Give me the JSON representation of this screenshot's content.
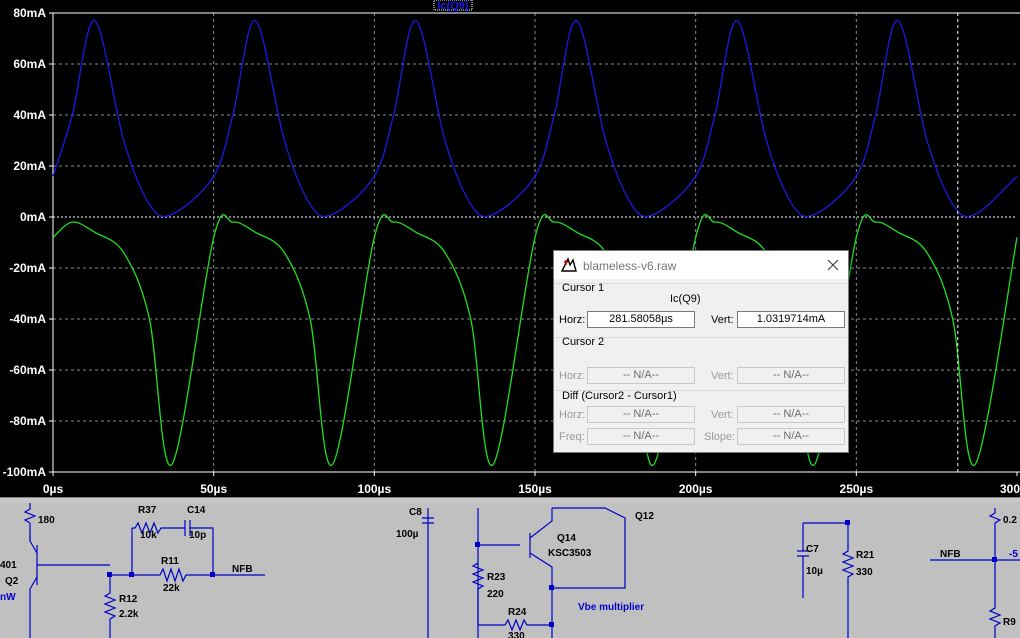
{
  "plot": {
    "trace_label": "Ic(Q9)",
    "colors": {
      "background": "#000000",
      "grid": "#8a8a8a",
      "trace1": "#1a1ae6",
      "trace2": "#1ee01e",
      "zero_line": "#ffffff",
      "cursor": "#ffffff"
    },
    "y_axis": {
      "ticks": [
        "80mA",
        "60mA",
        "40mA",
        "20mA",
        "0mA",
        "-20mA",
        "-40mA",
        "-60mA",
        "-80mA",
        "-100mA"
      ]
    },
    "x_axis": {
      "ticks": [
        "0µs",
        "50µs",
        "100µs",
        "150µs",
        "200µs",
        "250µs",
        "300"
      ]
    }
  },
  "chart_data": {
    "type": "line",
    "xlim": [
      0,
      300
    ],
    "ylim": [
      -100,
      80
    ],
    "x_unit": "µs",
    "y_unit": "mA",
    "period_us": 50,
    "cursor_x_us": 281.58058,
    "series": [
      {
        "name": "Ic(Q9)",
        "x": [
          0,
          6,
          13,
          22,
          30,
          37,
          50,
          56,
          63,
          72,
          80,
          87,
          100,
          106,
          113,
          122,
          130,
          137,
          150,
          156,
          163,
          172,
          180,
          187,
          200,
          206,
          213,
          222,
          230,
          237,
          250,
          256,
          263,
          272,
          280,
          287,
          300
        ],
        "values": [
          16,
          40,
          77,
          30,
          5,
          1,
          16,
          40,
          77,
          30,
          5,
          1,
          16,
          40,
          77,
          30,
          5,
          1,
          16,
          40,
          77,
          30,
          5,
          1,
          16,
          40,
          77,
          30,
          5,
          1,
          16,
          40,
          77,
          30,
          5,
          1,
          16
        ]
      },
      {
        "x": [
          0,
          6,
          13,
          22,
          30,
          37,
          50,
          56,
          63,
          72,
          80,
          87,
          100,
          106,
          113,
          122,
          130,
          137,
          150,
          156,
          163,
          172,
          180,
          187,
          200,
          206,
          213,
          222,
          230,
          237,
          250,
          256,
          263,
          272,
          280,
          287,
          300
        ],
        "values": [
          -8,
          -2,
          -6,
          -14,
          -40,
          -97,
          -8,
          -2,
          -6,
          -14,
          -40,
          -97,
          -8,
          -2,
          -6,
          -14,
          -40,
          -97,
          -8,
          -2,
          -6,
          -14,
          -40,
          -97,
          -8,
          -2,
          -6,
          -14,
          -40,
          -97,
          -8,
          -2,
          -6,
          -14,
          -40,
          -97,
          -8
        ]
      }
    ]
  },
  "cursor_dialog": {
    "title": "blameless-v6.raw",
    "cursor1": {
      "heading": "Cursor 1",
      "trace": "Ic(Q9)",
      "horz_label": "Horz:",
      "horz_value": "281.58058µs",
      "vert_label": "Vert:",
      "vert_value": "1.0319714mA"
    },
    "cursor2": {
      "heading": "Cursor 2",
      "horz_label": "Horz:",
      "horz_value": "-- N/A--",
      "vert_label": "Vert:",
      "vert_value": "-- N/A--"
    },
    "diff": {
      "heading": "Diff (Cursor2 - Cursor1)",
      "horz_label": "Horz:",
      "horz_value": "-- N/A--",
      "vert_label": "Vert:",
      "vert_value": "-- N/A--",
      "freq_label": "Freq:",
      "freq_value": "-- N/A--",
      "slope_label": "Slope:",
      "slope_value": "-- N/A--"
    }
  },
  "schematic": {
    "labels": {
      "r_top_left": "180",
      "r37": "R37",
      "r37_val": "10k",
      "c14": "C14",
      "c14_val": "10p",
      "r11": "R11",
      "r11_val": "22k",
      "nfb1": "NFB",
      "q2_part": "401",
      "q2": "Q2",
      "q2_extra": "nW",
      "r12": "R12",
      "r12_val": "2.2k",
      "c8": "C8",
      "c8_val": "100µ",
      "q14": "Q14",
      "q14_part": "KSC3503",
      "q12": "Q12",
      "r23": "R23",
      "r23_val": "220",
      "r24": "R24",
      "r24_val": "330",
      "vbe": "Vbe multiplier",
      "c7": "C7",
      "c7_val": "10µ",
      "r21": "R21",
      "r21_val": "330",
      "nfb2": "NFB",
      "right_val": "0.2",
      "right_minus": "-5",
      "r9": "R9"
    }
  }
}
